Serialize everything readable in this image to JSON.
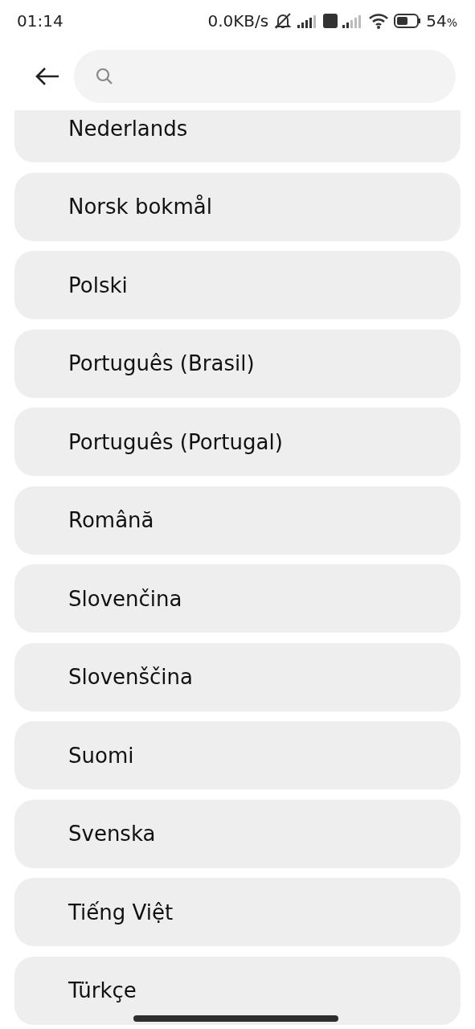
{
  "status_bar": {
    "time": "01:14",
    "network_speed": "0.0KB/s",
    "battery": "54",
    "battery_unit": "%"
  },
  "languages": [
    {
      "label": "Nederlands"
    },
    {
      "label": "Norsk bokmål"
    },
    {
      "label": "Polski"
    },
    {
      "label": "Português (Brasil)"
    },
    {
      "label": "Português (Portugal)"
    },
    {
      "label": "Română"
    },
    {
      "label": "Slovenčina"
    },
    {
      "label": "Slovenščina"
    },
    {
      "label": "Suomi"
    },
    {
      "label": "Svenska"
    },
    {
      "label": "Tiếng Việt"
    },
    {
      "label": "Türkçe"
    }
  ]
}
